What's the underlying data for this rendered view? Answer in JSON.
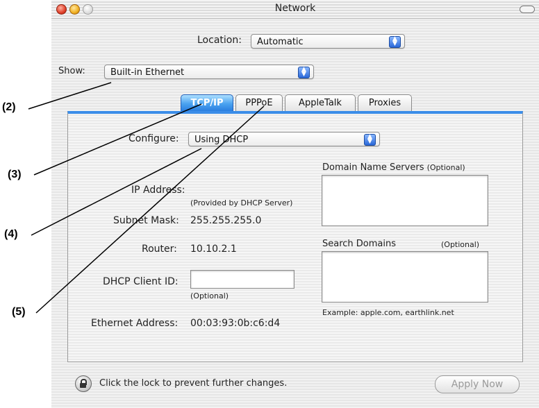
{
  "window": {
    "title": "Network"
  },
  "location": {
    "label": "Location:",
    "value": "Automatic"
  },
  "show": {
    "label": "Show:",
    "value": "Built-in Ethernet"
  },
  "tabs": [
    {
      "label": "TCP/IP",
      "active": true
    },
    {
      "label": "PPPoE",
      "active": false
    },
    {
      "label": "AppleTalk",
      "active": false
    },
    {
      "label": "Proxies",
      "active": false
    }
  ],
  "tcpip": {
    "configure_label": "Configure:",
    "configure_value": "Using DHCP",
    "ip_label": "IP Address:",
    "ip_note": "(Provided by DHCP Server)",
    "subnet_label": "Subnet Mask:",
    "subnet_value": "255.255.255.0",
    "router_label": "Router:",
    "router_value": "10.10.2.1",
    "dhcp_label": "DHCP Client ID:",
    "dhcp_value": "",
    "dhcp_note": "(Optional)",
    "ethernet_label": "Ethernet Address:",
    "ethernet_value": "00:03:93:0b:c6:d4",
    "dns_label": "Domain Name Servers",
    "dns_optional": "(Optional)",
    "search_label": "Search Domains",
    "search_optional": "(Optional)",
    "example": "Example: apple.com, earthlink.net"
  },
  "footer": {
    "lock_text": "Click the lock to prevent further changes.",
    "apply_label": "Apply Now"
  },
  "callouts": [
    "(2)",
    "(3)",
    "(4)",
    "(5)"
  ],
  "colors": {
    "accent": "#3b8de8",
    "tab_active": "#4aa2f0"
  }
}
